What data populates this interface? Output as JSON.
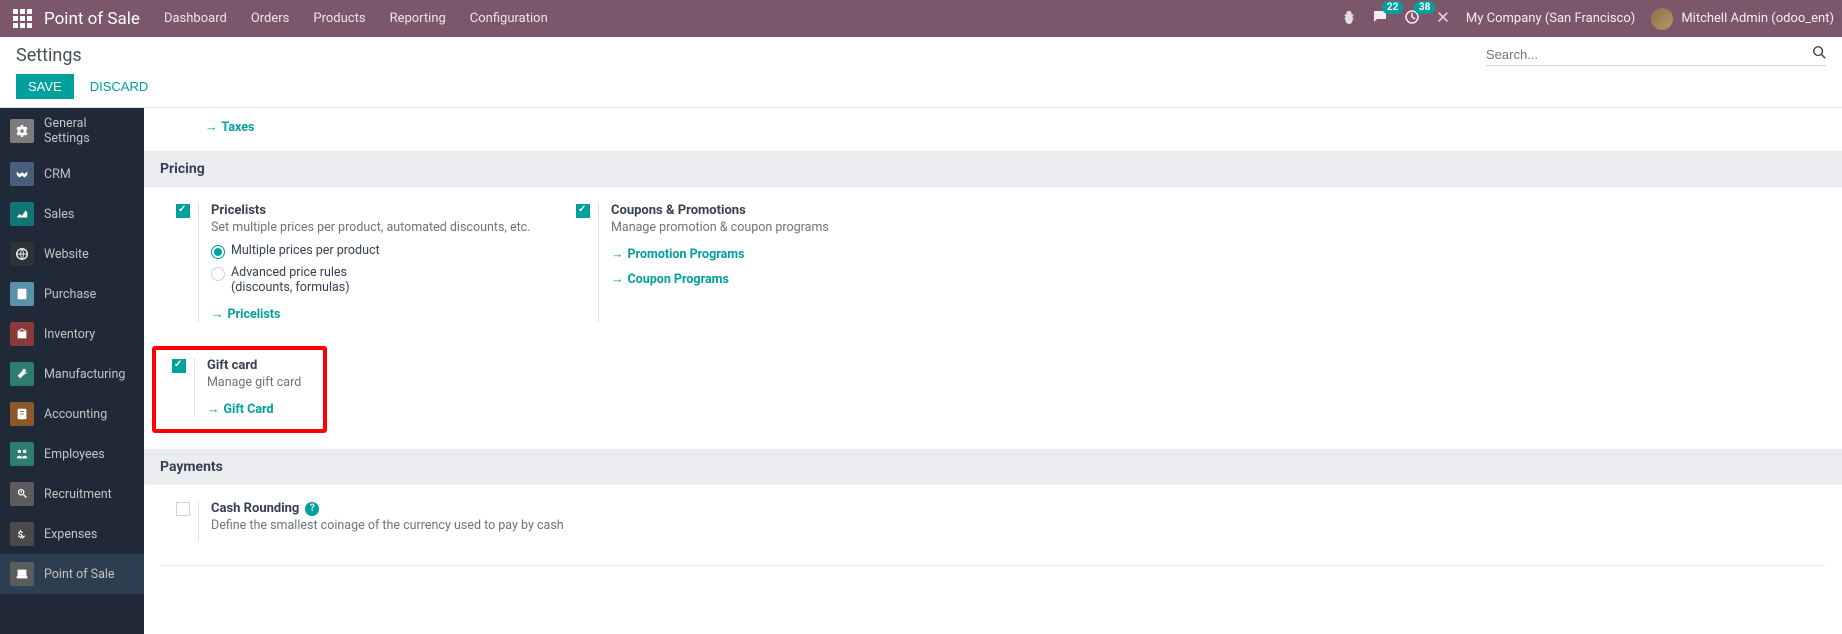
{
  "navbar": {
    "brand": "Point of Sale",
    "menu": [
      "Dashboard",
      "Orders",
      "Products",
      "Reporting",
      "Configuration"
    ],
    "messages_badge": "22",
    "activities_badge": "38",
    "company": "My Company (San Francisco)",
    "user": "Mitchell Admin (odoo_ent)"
  },
  "control_panel": {
    "breadcrumb": "Settings",
    "search_placeholder": "Search...",
    "save": "SAVE",
    "discard": "DISCARD"
  },
  "sidebar": {
    "items": [
      {
        "label": "General Settings",
        "icon": "general"
      },
      {
        "label": "CRM",
        "icon": "crm"
      },
      {
        "label": "Sales",
        "icon": "sales"
      },
      {
        "label": "Website",
        "icon": "website"
      },
      {
        "label": "Purchase",
        "icon": "purchase"
      },
      {
        "label": "Inventory",
        "icon": "inventory"
      },
      {
        "label": "Manufacturing",
        "icon": "manufacturing"
      },
      {
        "label": "Accounting",
        "icon": "accounting"
      },
      {
        "label": "Employees",
        "icon": "employees"
      },
      {
        "label": "Recruitment",
        "icon": "recruitment"
      },
      {
        "label": "Expenses",
        "icon": "expenses"
      },
      {
        "label": "Point of Sale",
        "icon": "pos",
        "active": true
      }
    ]
  },
  "content": {
    "taxes_link": "Taxes",
    "sections": {
      "pricing": {
        "title": "Pricing",
        "pricelists": {
          "title": "Pricelists",
          "desc": "Set multiple prices per product, automated discounts, etc.",
          "radio1": "Multiple prices per product",
          "radio2_line1": "Advanced price rules",
          "radio2_line2": "(discounts, formulas)",
          "link": "Pricelists"
        },
        "coupons": {
          "title": "Coupons & Promotions",
          "desc": "Manage promotion & coupon programs",
          "link1": "Promotion Programs",
          "link2": "Coupon Programs"
        },
        "giftcard": {
          "title": "Gift card",
          "desc": "Manage gift card",
          "link": "Gift Card"
        }
      },
      "payments": {
        "title": "Payments",
        "cash_rounding": {
          "title": "Cash Rounding",
          "desc": "Define the smallest coinage of the currency used to pay by cash"
        }
      }
    }
  }
}
